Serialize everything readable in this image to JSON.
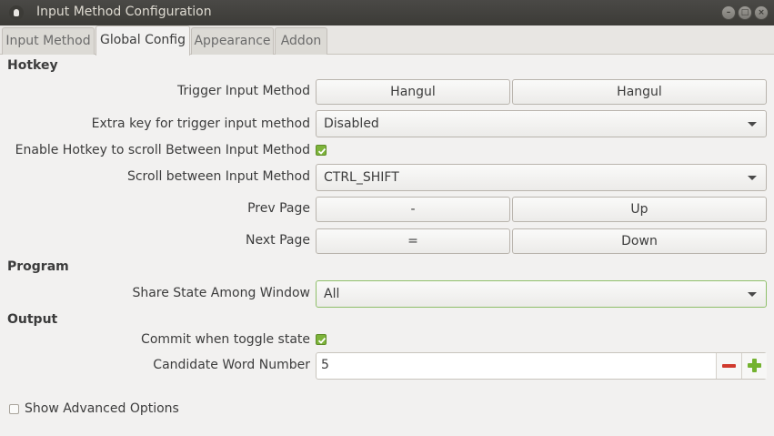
{
  "window": {
    "title": "Input Method Configuration"
  },
  "tabs": [
    {
      "label": "Input Method",
      "active": false
    },
    {
      "label": "Global Config",
      "active": true
    },
    {
      "label": "Appearance",
      "active": false
    },
    {
      "label": "Addon",
      "active": false
    }
  ],
  "sections": {
    "hotkey": "Hotkey",
    "program": "Program",
    "output": "Output"
  },
  "hotkey": {
    "trigger_label": "Trigger Input Method",
    "trigger_keys": [
      "Hangul",
      "Hangul"
    ],
    "extra_key_label": "Extra key for trigger input method",
    "extra_key_value": "Disabled",
    "enable_scroll_label": "Enable Hotkey to scroll Between Input Method",
    "enable_scroll_checked": true,
    "scroll_label": "Scroll between Input Method",
    "scroll_value": "CTRL_SHIFT",
    "prev_page_label": "Prev Page",
    "prev_page_keys": [
      "-",
      "Up"
    ],
    "next_page_label": "Next Page",
    "next_page_keys": [
      "=",
      "Down"
    ]
  },
  "program": {
    "share_state_label": "Share State Among Window",
    "share_state_value": "All"
  },
  "output": {
    "commit_label": "Commit when toggle state",
    "commit_checked": true,
    "candidate_label": "Candidate Word Number",
    "candidate_value": "5"
  },
  "footer": {
    "show_advanced_label": "Show Advanced Options",
    "show_advanced_checked": false
  },
  "colors": {
    "titlebar": "#3c3b37",
    "check_accent": "#7db33a",
    "minus": "#d03a2e",
    "plus": "#73b22f"
  }
}
